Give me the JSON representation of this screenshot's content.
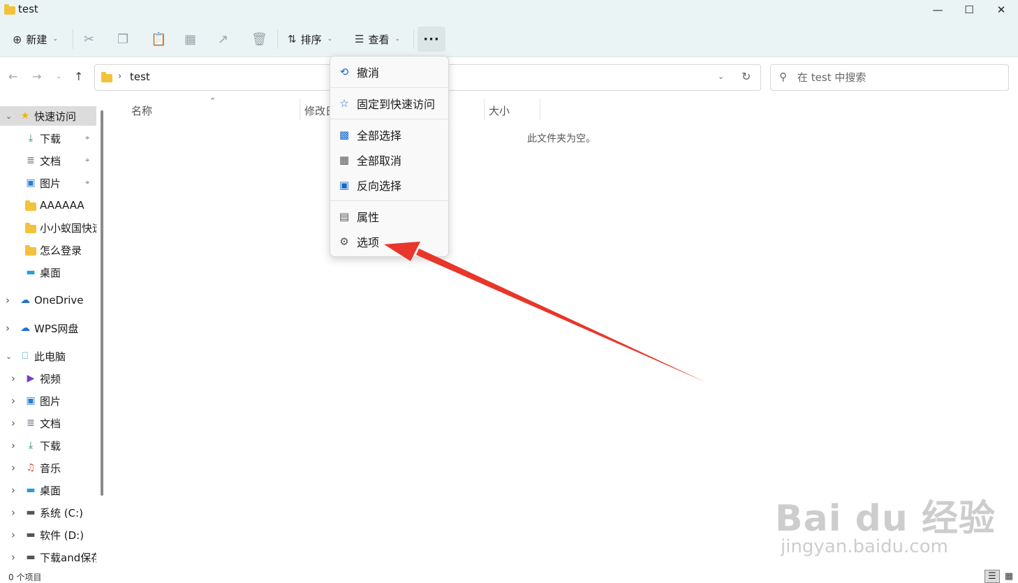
{
  "window": {
    "title": "test"
  },
  "toolbar": {
    "new_label": "新建",
    "sort_label": "排序",
    "view_label": "查看",
    "more_label": "···"
  },
  "address": {
    "path": "test"
  },
  "search": {
    "placeholder": "在 test 中搜索"
  },
  "sidebar": {
    "items": [
      {
        "label": "快速访问",
        "icon": "star-icon"
      },
      {
        "label": "下载",
        "icon": "download-icon"
      },
      {
        "label": "文档",
        "icon": "document-icon"
      },
      {
        "label": "图片",
        "icon": "picture-icon"
      },
      {
        "label": "AAAAAA",
        "icon": "folder-icon"
      },
      {
        "label": "小小蚁国快速",
        "icon": "folder-icon"
      },
      {
        "label": "怎么登录",
        "icon": "folder-icon"
      },
      {
        "label": "桌面",
        "icon": "desktop-icon"
      },
      {
        "label": "OneDrive",
        "icon": "cloud-icon"
      },
      {
        "label": "WPS网盘",
        "icon": "cloud-icon"
      },
      {
        "label": "此电脑",
        "icon": "computer-icon"
      },
      {
        "label": "视频",
        "icon": "video-icon"
      },
      {
        "label": "图片",
        "icon": "picture-icon"
      },
      {
        "label": "文档",
        "icon": "document-icon"
      },
      {
        "label": "下载",
        "icon": "download-icon"
      },
      {
        "label": "音乐",
        "icon": "music-icon"
      },
      {
        "label": "桌面",
        "icon": "desktop-icon"
      },
      {
        "label": "系统 (C:)",
        "icon": "drive-icon"
      },
      {
        "label": "软件 (D:)",
        "icon": "drive-icon"
      },
      {
        "label": "下载and保存",
        "icon": "drive-icon"
      }
    ]
  },
  "columns": {
    "name": "名称",
    "modified": "修改日",
    "size": "大小"
  },
  "empty_message": "此文件夹为空。",
  "menu": {
    "items": [
      {
        "label": "撤消",
        "icon": "undo-icon"
      },
      {
        "label": "固定到快速访问",
        "icon": "star-outline-icon"
      },
      {
        "label": "全部选择",
        "icon": "select-all-icon"
      },
      {
        "label": "全部取消",
        "icon": "select-none-icon"
      },
      {
        "label": "反向选择",
        "icon": "invert-selection-icon"
      },
      {
        "label": "属性",
        "icon": "properties-icon"
      },
      {
        "label": "选项",
        "icon": "options-icon"
      }
    ]
  },
  "status": {
    "count": "0 个项目"
  },
  "watermark": {
    "main": "Bai du 经验",
    "sub": "jingyan.baidu.com"
  },
  "colors": {
    "accent": "#1667c5",
    "folder": "#f3c23c",
    "arrow": "#e8362a",
    "toolbar_bg": "#eaf4f5"
  }
}
